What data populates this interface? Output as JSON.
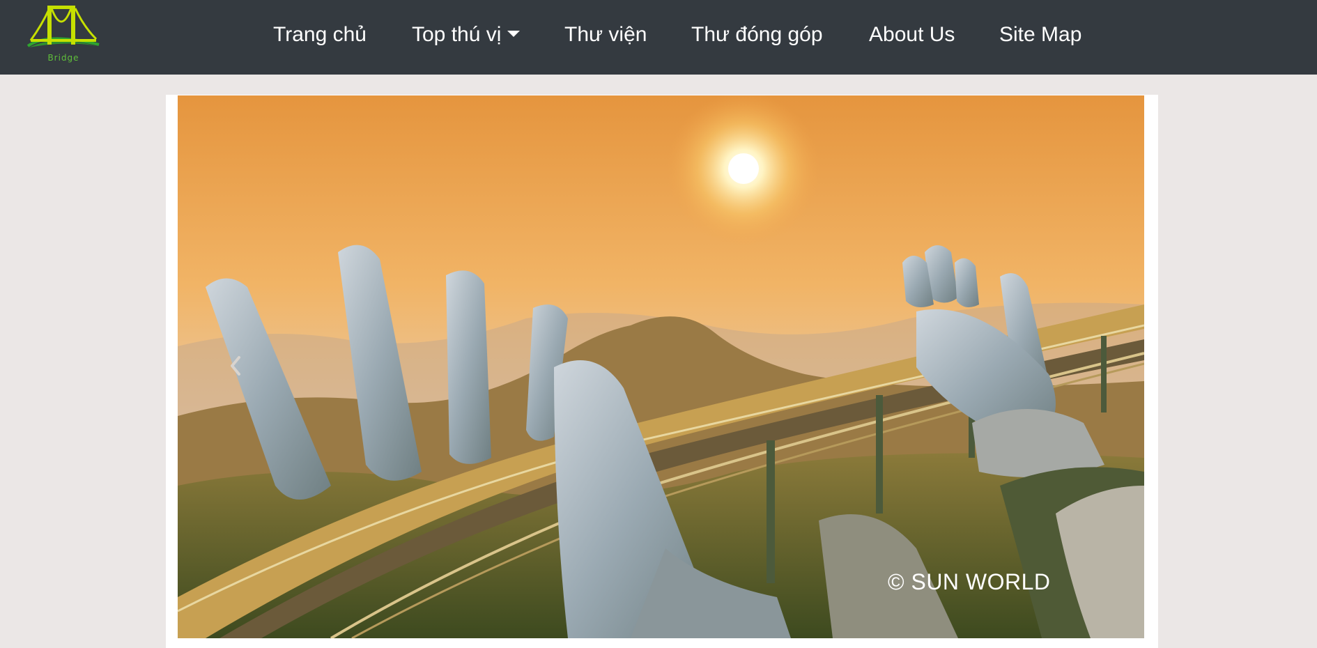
{
  "brand": {
    "name": "Bridge"
  },
  "nav": {
    "items": [
      {
        "label": "Trang chủ"
      },
      {
        "label": "Top thú vị",
        "has_dropdown": true
      },
      {
        "label": "Thư viện"
      },
      {
        "label": "Thư đóng góp"
      },
      {
        "label": "About Us"
      },
      {
        "label": "Site Map"
      }
    ]
  },
  "carousel": {
    "slide": {
      "watermark": "© SUN WORLD"
    },
    "prev_icon": "chevron-left-icon"
  },
  "colors": {
    "navbar_bg": "#343a40",
    "page_bg": "#ebe7e6",
    "brand_accent": "#c6e000",
    "brand_text": "#5fbf3a"
  }
}
